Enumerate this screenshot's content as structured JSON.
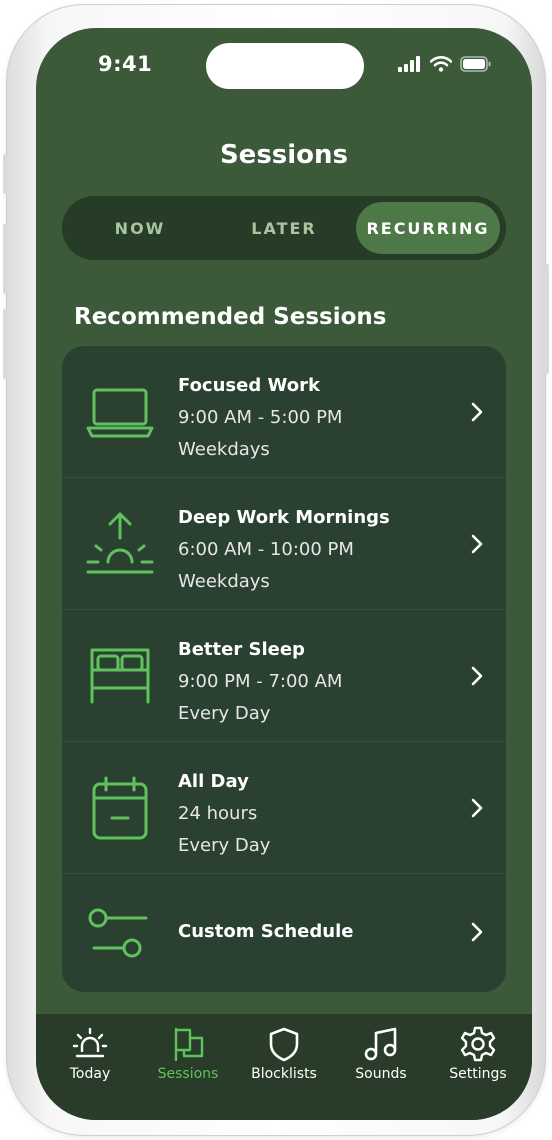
{
  "status_bar": {
    "time": "9:41"
  },
  "header": {
    "title": "Sessions"
  },
  "segments": [
    {
      "label": "NOW",
      "active": false
    },
    {
      "label": "LATER",
      "active": false
    },
    {
      "label": "RECURRING",
      "active": true
    }
  ],
  "recommended": {
    "title": "Recommended Sessions",
    "items": [
      {
        "icon": "laptop-icon",
        "title": "Focused Work",
        "time": "9:00 AM - 5:00 PM",
        "days": "Weekdays"
      },
      {
        "icon": "sunrise-icon",
        "title": "Deep Work Mornings",
        "time": "6:00 AM - 10:00 PM",
        "days": "Weekdays"
      },
      {
        "icon": "bed-icon",
        "title": "Better Sleep",
        "time": "9:00 PM - 7:00 AM",
        "days": "Every Day"
      },
      {
        "icon": "calendar-icon",
        "title": "All Day",
        "time": "24 hours",
        "days": "Every Day"
      },
      {
        "icon": "sliders-icon",
        "title": "Custom Schedule"
      }
    ]
  },
  "tabs": [
    {
      "label": "Today",
      "icon": "alarm-light-icon",
      "active": false
    },
    {
      "label": "Sessions",
      "icon": "flag-icon",
      "active": true
    },
    {
      "label": "Blocklists",
      "icon": "shield-icon",
      "active": false
    },
    {
      "label": "Sounds",
      "icon": "music-note-icon",
      "active": false
    },
    {
      "label": "Settings",
      "icon": "gear-icon",
      "active": false
    }
  ],
  "colors": {
    "background": "#3c5a3a",
    "card": "#2a4030",
    "accent_green": "#5fc25d",
    "segment_active": "#4e7848",
    "tabbar": "#283c29"
  }
}
